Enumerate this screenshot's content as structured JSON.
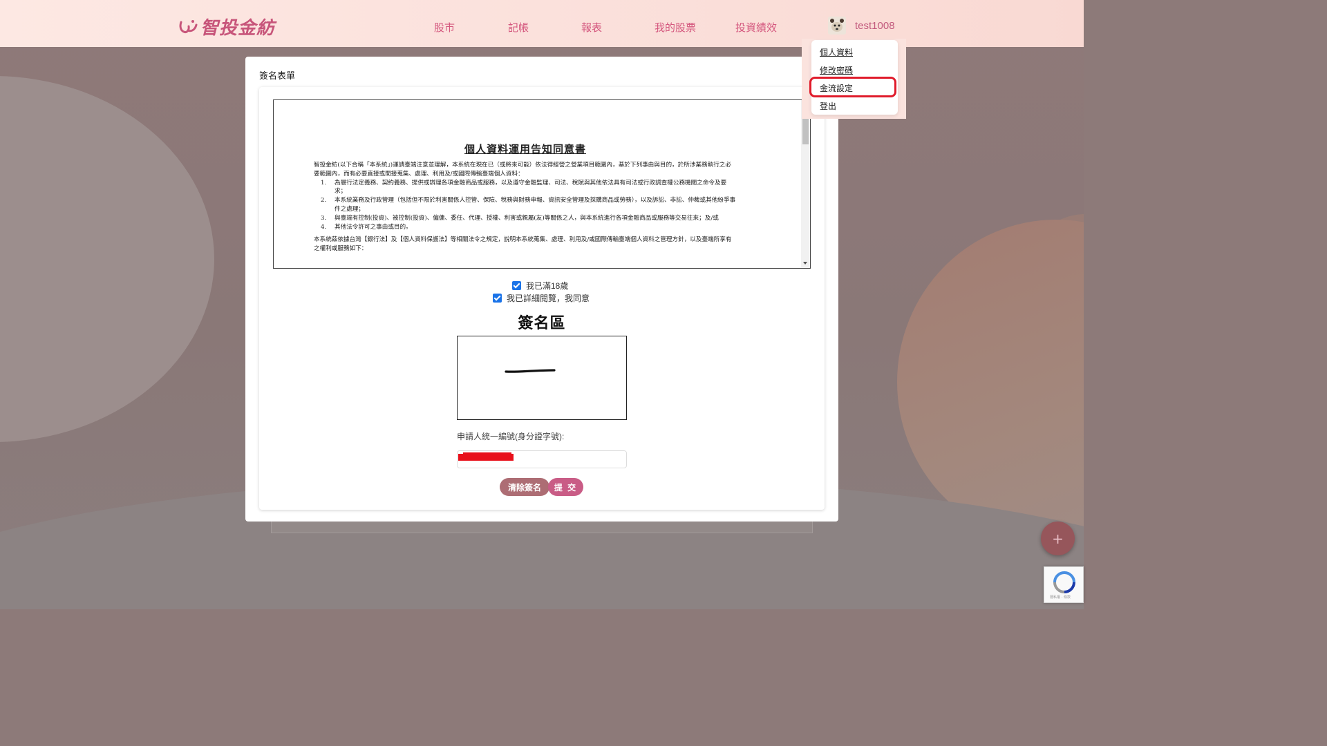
{
  "nav": {
    "logo_text": "智投金紡",
    "links": [
      "股市",
      "記帳",
      "報表",
      "我的股票",
      "投資績效"
    ],
    "username": "test1008"
  },
  "user_menu": {
    "items": [
      "個人資料",
      "修改密碼",
      "金流設定",
      "登出"
    ],
    "highlighted_item": "金流設定",
    "highlight_color": "#e01b2b"
  },
  "modal": {
    "title": "簽名表單",
    "document": {
      "heading": "個人資料運用告知同意書",
      "intro": "智投金紡(以下合稱「本系統」)運請臺端注意並理解，本系統在現在已（或將來可能）依法得經營之營業項目範圍內，基於下列事由與目的，於所涉業務執行之必要範圍內，而有必要直接或間接蒐集、處理、利用及/或國際傳輸臺端個人資料：",
      "items": [
        {
          "num": "1.",
          "text": "為履行法定義務、契約義務、提供或辦理各項金融商品或服務，以及遵守金融監理、司法、稅賦與其他依法具有司法或行政調查權公務機關之命令及要求；"
        },
        {
          "num": "2.",
          "text": "本系統業務及行政管理（包括但不限於利害關係人控管、保險、稅務與財務申報、資訊安全管理及採購商品或勞務），以及訴訟、非訟、仲裁或其他紛爭事件之處理；"
        },
        {
          "num": "3.",
          "text": "與臺端有控制(投資)、被控制(投資)、僱傭、委任、代理、授權、利害或親屬(友)等關係之人，與本系統進行各項金融商品或服務等交易往來；及/或"
        },
        {
          "num": "4.",
          "text": "其他法令許可之事由或目的。"
        }
      ],
      "closing": "本系統茲依據台灣【銀行法】及【個人資料保護法】等相關法令之規定，說明本系統蒐集、處理、利用及/或國際傳輸臺端個人資料之管理方針，以及臺端所享有之權利或服務如下："
    },
    "checkbox_age": {
      "label": "我已滿18歲",
      "checked": true
    },
    "checkbox_agree": {
      "label": "我已詳細閱覽，我同意",
      "checked": true
    },
    "sign_area_title": "簽名區",
    "id_label": "申請人統一編號(身分證字號):",
    "id_value_redacted": true,
    "clear_button": "清除簽名",
    "submit_button": "提 交"
  },
  "fab_icon": "plus-icon",
  "recaptcha": {
    "text": "隱私權 - 條款"
  },
  "colors": {
    "brand_pink": "#d4577e",
    "checkbox_blue": "#1a73e8",
    "clear_button": "#ad6d74",
    "submit_button": "#c95c86"
  }
}
